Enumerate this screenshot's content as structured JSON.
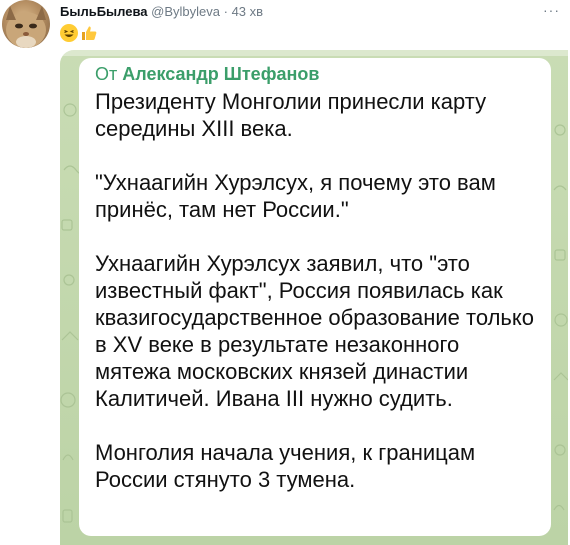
{
  "tweet": {
    "display_name": "БыльБылева",
    "handle": "@Bylbyleva",
    "separator": "·",
    "time": "43 хв",
    "more_icon": "more-horizontal-icon",
    "emojis": [
      "grinning-squinting-face",
      "thumbs-up"
    ]
  },
  "telegram_post": {
    "forward_prefix": "От",
    "forward_author": "Александр Штефанов",
    "paragraphs": [
      "Президенту Монголии принесли карту середины XIII века.",
      "\"Ухнаагийн Хурэлсух, я почему это вам принёс, там нет России.\"",
      "Ухнаагийн Хурэлсух заявил, что \"это известный факт\", Россия появилась как квазигосударственное образование только в XV веке в результате незаконного мятежа московских князей династии Калитичей. Ивана III нужно судить.",
      "Монголия начала учения, к границам России стянуто 3 тумена."
    ]
  },
  "colors": {
    "forward_green": "#3b9e6a",
    "background_green": "#c9dcb4",
    "text_dark": "#0f1419",
    "meta_gray": "#6e7a85"
  }
}
